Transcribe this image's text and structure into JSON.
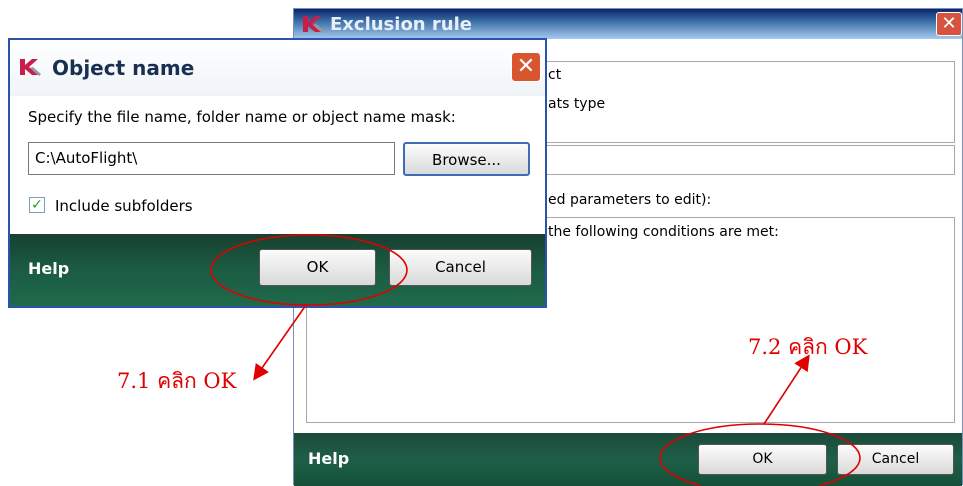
{
  "exclusion_window": {
    "title": "Exclusion rule",
    "close_symbol": "✕",
    "lines": {
      "object": "ct",
      "threats": "ats type",
      "parameters": "ed parameters to edit):",
      "conditions": "the following conditions are met:"
    },
    "footer": {
      "help": "Help",
      "ok": "OK",
      "cancel": "Cancel"
    }
  },
  "object_name_dialog": {
    "title": "Object name",
    "close_symbol": "✕",
    "instruction": "Specify the file name, folder name or object name mask:",
    "path_value": "C:\\AutoFlight\\",
    "browse_label": "Browse...",
    "include_subfolders_label": "Include subfolders",
    "include_subfolders_checked": true,
    "footer": {
      "help": "Help",
      "ok": "OK",
      "cancel": "Cancel"
    }
  },
  "annotations": {
    "step_1": "7.1 คลิก OK",
    "step_2": "7.2 คลิก OK",
    "color": "#e00000"
  },
  "icons": [
    "kaspersky-logo-icon",
    "close-icon",
    "checkmark-icon"
  ]
}
